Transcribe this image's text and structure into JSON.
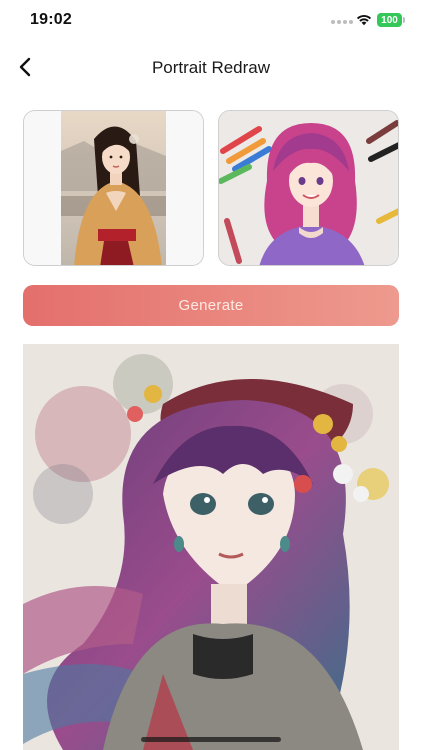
{
  "status_bar": {
    "time": "19:02",
    "battery_level": "100",
    "icons": [
      "signal-icon",
      "wifi-icon",
      "battery-icon"
    ],
    "battery_color": "#34c759"
  },
  "nav": {
    "title": "Portrait Redraw",
    "back_icon": "chevron-left-icon"
  },
  "inputs": {
    "source_photo": "portrait photo of woman in traditional dress",
    "style_reference": "colored pencil drawing of girl with pink hair"
  },
  "actions": {
    "generate_label": "Generate",
    "accent_gradient": [
      "#e46f6c",
      "#ee9a8e"
    ]
  },
  "result": {
    "image": "watercolor sketch portrait of girl with purple hair and flowers"
  }
}
